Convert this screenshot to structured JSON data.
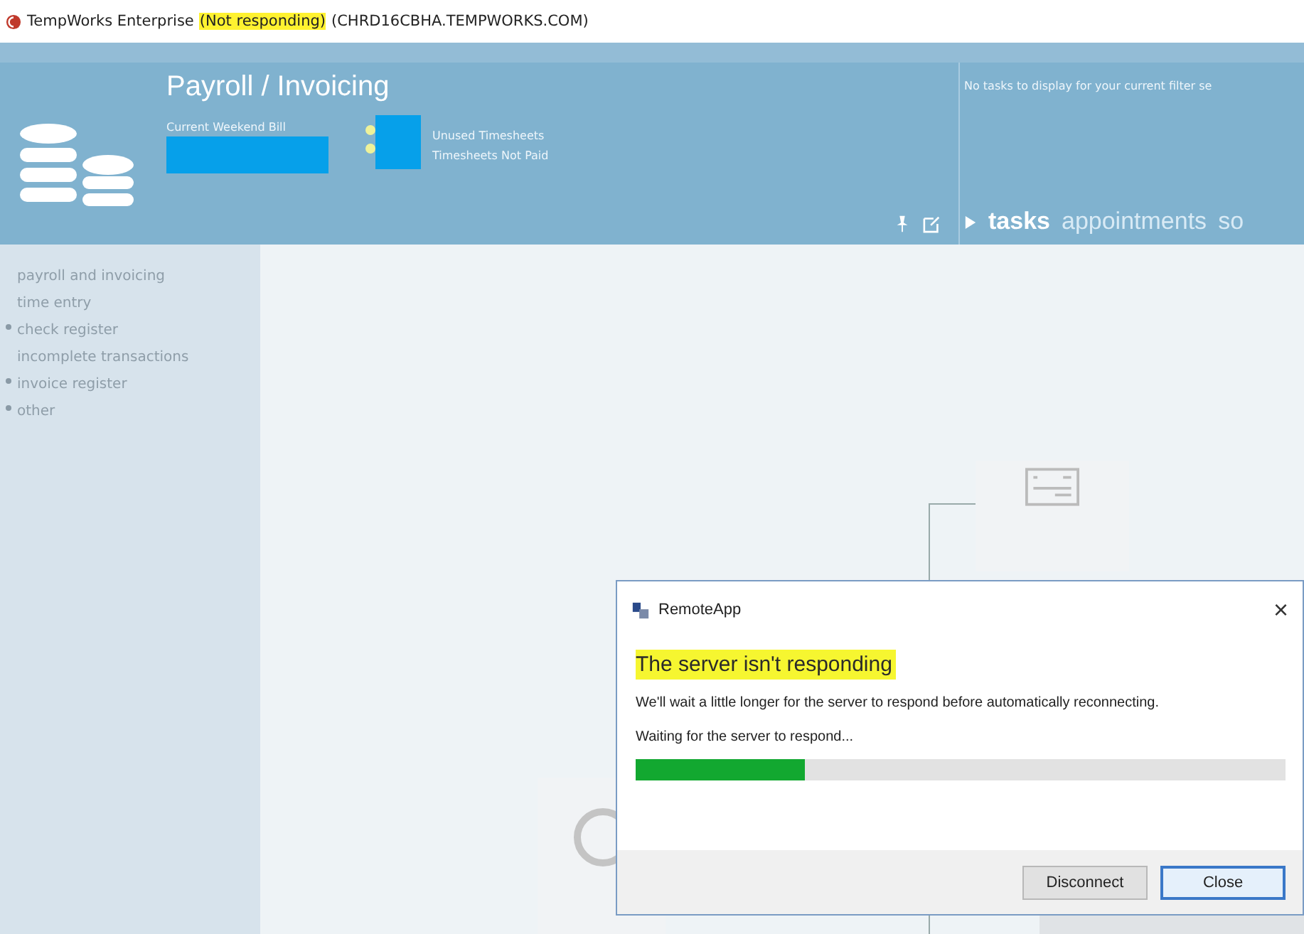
{
  "window": {
    "title_segments": [
      {
        "text": "TempWorks Enterprise",
        "highlighted": false
      },
      {
        "text": "(Not responding)",
        "highlighted": true
      },
      {
        "text": "(CHRD16CBHA.TEMPWORKS.COM)",
        "highlighted": false
      }
    ]
  },
  "header": {
    "title": "Payroll / Invoicing",
    "bill_label": "Current Weekend Bill",
    "timesheet_labels": [
      "Unused Timesheets",
      "Timesheets Not Paid"
    ]
  },
  "task_panel": {
    "message": "No tasks to display for your current filter se",
    "tabs": [
      {
        "label": "tasks",
        "selected": true
      },
      {
        "label": "appointments",
        "selected": false
      },
      {
        "label": "so",
        "selected": false
      }
    ]
  },
  "sidebar": {
    "items": [
      {
        "label": "payroll and invoicing",
        "bulleted": false
      },
      {
        "label": "time entry",
        "bulleted": false
      },
      {
        "label": "check register",
        "bulleted": true
      },
      {
        "label": "incomplete transactions",
        "bulleted": false
      },
      {
        "label": "invoice register",
        "bulleted": true
      },
      {
        "label": "other",
        "bulleted": true
      }
    ]
  },
  "dialog": {
    "title": "RemoteApp",
    "close": "×",
    "heading": "The server isn't responding",
    "heading_highlighted": true,
    "message": "We'll wait a little longer for the server to respond before automatically reconnecting.",
    "status": "Waiting for the server to respond...",
    "progress": {
      "level": 0.26
    },
    "buttons": [
      {
        "label": "Disconnect",
        "default": false
      },
      {
        "label": "Close",
        "default": true
      }
    ]
  }
}
